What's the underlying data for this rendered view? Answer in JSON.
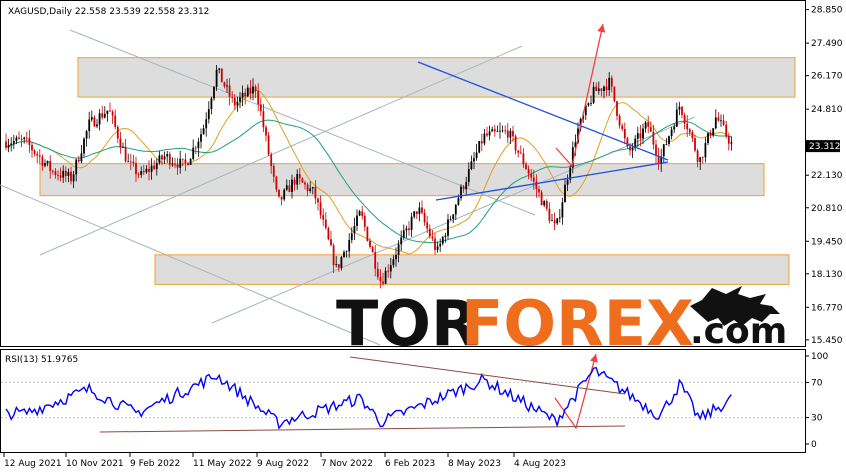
{
  "chart_data": [
    {
      "type": "candlestick",
      "header": "XAGUSD,Daily  22.558 23.539 22.558 23.312",
      "symbol": "XAGUSD",
      "timeframe": "Daily",
      "ohlc_last": {
        "open": 22.558,
        "high": 23.539,
        "low": 22.558,
        "close": 23.312
      },
      "current_price_label": "23.312",
      "y_ticks": [
        "28.850",
        "27.490",
        "26.170",
        "24.810",
        "23.312",
        "22.130",
        "20.810",
        "19.450",
        "18.130",
        "16.770",
        "15.450"
      ],
      "ylim": [
        15.2,
        29.2
      ],
      "x_ticks": [
        "12 Aug 2021",
        "10 Nov 2021",
        "9 Feb 2022",
        "11 May 2022",
        "9 Aug 2022",
        "7 Nov 2022",
        "6 Feb 2023",
        "8 May 2023",
        "4 Aug 2023"
      ],
      "grid": false,
      "series_close_approx": [
        {
          "date": "2021-08-12",
          "value": 23.5
        },
        {
          "date": "2021-09-10",
          "value": 22.3
        },
        {
          "date": "2021-10-01",
          "value": 22.0
        },
        {
          "date": "2021-10-20",
          "value": 24.2
        },
        {
          "date": "2021-11-10",
          "value": 24.8
        },
        {
          "date": "2021-12-01",
          "value": 22.6
        },
        {
          "date": "2021-12-15",
          "value": 22.1
        },
        {
          "date": "2022-01-10",
          "value": 22.9
        },
        {
          "date": "2022-01-31",
          "value": 22.5
        },
        {
          "date": "2022-02-20",
          "value": 24.0
        },
        {
          "date": "2022-03-07",
          "value": 26.4
        },
        {
          "date": "2022-03-25",
          "value": 25.0
        },
        {
          "date": "2022-04-18",
          "value": 25.7
        },
        {
          "date": "2022-05-12",
          "value": 21.0
        },
        {
          "date": "2022-05-31",
          "value": 22.0
        },
        {
          "date": "2022-06-20",
          "value": 21.4
        },
        {
          "date": "2022-07-14",
          "value": 18.3
        },
        {
          "date": "2022-08-09",
          "value": 20.6
        },
        {
          "date": "2022-08-31",
          "value": 17.8
        },
        {
          "date": "2022-09-20",
          "value": 19.3
        },
        {
          "date": "2022-10-10",
          "value": 20.8
        },
        {
          "date": "2022-10-31",
          "value": 19.0
        },
        {
          "date": "2022-11-20",
          "value": 21.0
        },
        {
          "date": "2022-12-20",
          "value": 23.7
        },
        {
          "date": "2023-01-15",
          "value": 23.9
        },
        {
          "date": "2023-02-06",
          "value": 22.3
        },
        {
          "date": "2023-03-08",
          "value": 19.9
        },
        {
          "date": "2023-03-30",
          "value": 23.8
        },
        {
          "date": "2023-04-18",
          "value": 25.5
        },
        {
          "date": "2023-05-05",
          "value": 25.9
        },
        {
          "date": "2023-05-25",
          "value": 23.0
        },
        {
          "date": "2023-06-15",
          "value": 24.2
        },
        {
          "date": "2023-06-28",
          "value": 22.7
        },
        {
          "date": "2023-07-20",
          "value": 25.0
        },
        {
          "date": "2023-08-10",
          "value": 22.7
        },
        {
          "date": "2023-08-28",
          "value": 24.5
        },
        {
          "date": "2023-09-15",
          "value": 23.3
        }
      ],
      "support_resistance_zones": [
        {
          "from": 25.3,
          "to": 26.9,
          "label": "resistance"
        },
        {
          "from": 21.3,
          "to": 22.6,
          "label": "support"
        },
        {
          "from": 17.7,
          "to": 18.9,
          "label": "support"
        }
      ],
      "colors": {
        "up": "#000000",
        "down": "#d00000",
        "ma_fast": "#e0a020",
        "ma_slow": "#20a080",
        "trend": "#1e50dc",
        "channel": "#a8b4bc",
        "arrow": "#f04040",
        "zone_fill": "#d7d7d7",
        "zone_border": "#f0a030"
      }
    },
    {
      "type": "line",
      "header": "RSI(13) 51.9765",
      "indicator": "RSI",
      "period": 13,
      "current_value": 51.9765,
      "ylim": [
        0,
        100
      ],
      "y_ticks": [
        "100",
        "70",
        "30",
        "0"
      ],
      "levels": [
        30,
        70
      ],
      "series_approx": [
        {
          "date": "2021-08-12",
          "value": 35
        },
        {
          "date": "2021-10-20",
          "value": 62
        },
        {
          "date": "2021-12-10",
          "value": 35
        },
        {
          "date": "2022-03-07",
          "value": 78
        },
        {
          "date": "2022-05-12",
          "value": 24
        },
        {
          "date": "2022-08-09",
          "value": 52
        },
        {
          "date": "2022-08-31",
          "value": 25
        },
        {
          "date": "2022-12-20",
          "value": 73
        },
        {
          "date": "2023-03-08",
          "value": 26
        },
        {
          "date": "2023-04-18",
          "value": 84
        },
        {
          "date": "2023-06-28",
          "value": 32
        },
        {
          "date": "2023-07-20",
          "value": 68
        },
        {
          "date": "2023-08-10",
          "value": 28
        },
        {
          "date": "2023-09-15",
          "value": 52
        }
      ],
      "color": "#0000ff"
    }
  ],
  "watermark": {
    "brand_dark": "TOR",
    "brand_accent": "FOREX",
    "suffix": ".com"
  }
}
